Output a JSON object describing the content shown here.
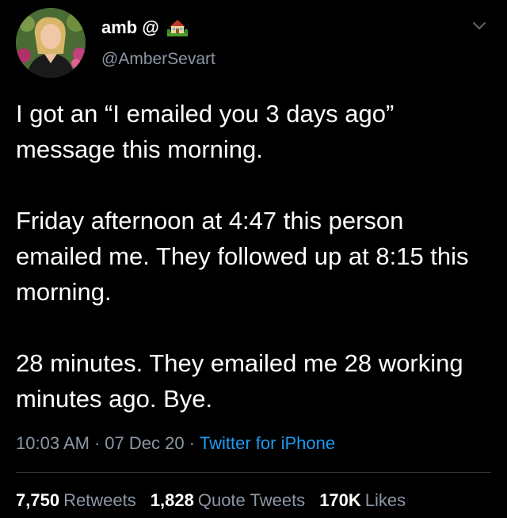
{
  "author": {
    "display_name": "amb @",
    "handle": "@AmberSevart",
    "avatar_icon": "profile-photo",
    "name_emoji": "house-with-garden-icon"
  },
  "tweet": {
    "paragraphs": [
      "I got an “I emailed you 3 days ago” message this morning.",
      "Friday afternoon at 4:47 this person emailed me. They followed up at 8:15 this morning.",
      "28 minutes. They emailed me 28 working minutes ago. Bye."
    ],
    "time": "10:03 AM",
    "separator": "·",
    "date": "07 Dec 20",
    "source": "Twitter for iPhone"
  },
  "stats": {
    "retweets_count": "7,750",
    "retweets_label": "Retweets",
    "quotes_count": "1,828",
    "quotes_label": "Quote Tweets",
    "likes_count": "170K",
    "likes_label": "Likes"
  },
  "colors": {
    "background": "#000000",
    "text": "#ffffff",
    "secondary": "#8b98a5",
    "link": "#1d9bf0",
    "divider": "#2f3336"
  }
}
